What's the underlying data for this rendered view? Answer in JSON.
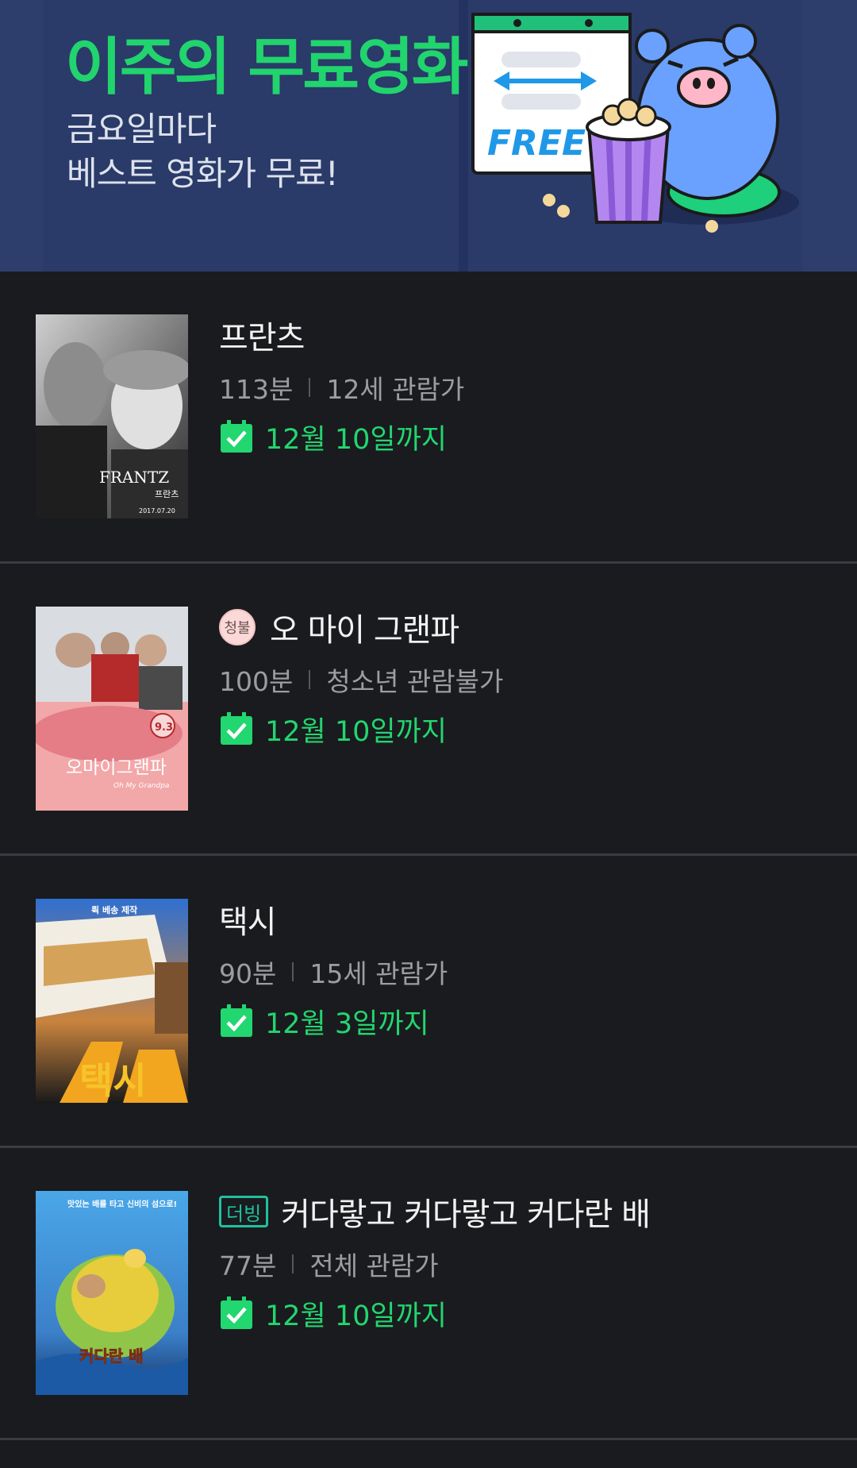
{
  "banner": {
    "title": "이주의 무료영화",
    "subtitle_line1": "금요일마다",
    "subtitle_line2": "베스트 영화가 무료!",
    "poster_sign": "FREE",
    "accent_color": "#21d46d"
  },
  "movies": [
    {
      "title": "프란츠",
      "runtime": "113분",
      "rating": "12세 관람가",
      "until": "12월 10일까지",
      "badge": "",
      "poster_title": "FRANTZ",
      "poster_subtitle": "프란츠",
      "poster_date": "2017.07.20"
    },
    {
      "title": "오 마이 그랜파",
      "runtime": "100분",
      "rating": "청소년 관람불가",
      "until": "12월 10일까지",
      "badge": "청불",
      "poster_title": "오마이그랜파",
      "poster_subtitle": "Oh My Grandpa",
      "poster_date": "9.3"
    },
    {
      "title": "택시",
      "runtime": "90분",
      "rating": "15세 관람가",
      "until": "12월 3일까지",
      "badge": "",
      "poster_title": "택시",
      "poster_top": "뤽 베송 제작"
    },
    {
      "title": "커다랗고 커다랗고 커다란 배",
      "runtime": "77분",
      "rating": "전체 관람가",
      "until": "12월 10일까지",
      "badge": "더빙",
      "poster_title": "커다란 배",
      "poster_top": "맛있는 배를 타고 신비의 섬으로!"
    }
  ],
  "icons": {
    "calendar_check": "calendar-check-icon"
  },
  "colors": {
    "background": "#1a1b1e",
    "date_green": "#22d670",
    "dub_badge": "#1fc1a1",
    "adult_badge_bg": "#fbd9d9"
  }
}
